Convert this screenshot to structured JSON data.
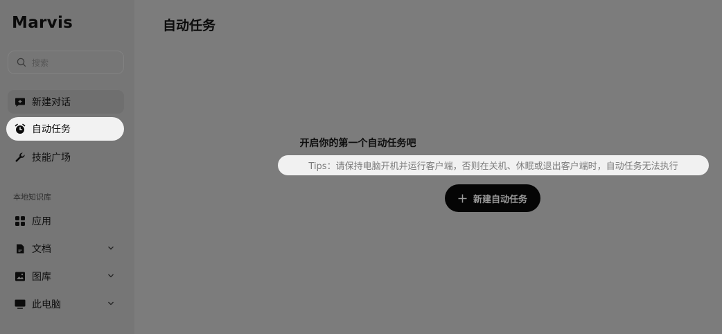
{
  "app": {
    "logo": "Marvis"
  },
  "sidebar": {
    "search_placeholder": "搜索",
    "items": [
      {
        "label": "新建对话",
        "icon": "chat-plus-icon"
      },
      {
        "label": "自动任务",
        "icon": "alarm-clock-icon"
      },
      {
        "label": "技能广场",
        "icon": "wrench-icon"
      }
    ],
    "section_label": "本地知识库",
    "library": [
      {
        "label": "应用",
        "icon": "apps-grid-icon"
      },
      {
        "label": "文档",
        "icon": "document-icon"
      },
      {
        "label": "图库",
        "icon": "image-icon"
      },
      {
        "label": "此电脑",
        "icon": "monitor-icon"
      }
    ]
  },
  "main": {
    "title": "自动任务",
    "empty_title": "开启你的第一个自动任务吧",
    "tips": "Tips：请保持电脑开机并运行客户端，否则在关机、休眠或退出客户端时，自动任务无法执行",
    "new_task_button": "新建自动任务"
  },
  "colors": {
    "overlay_sidebar": "#767676",
    "overlay_main": "#7c7c7c",
    "active_item": "#f2f2f2",
    "button_bg": "#050505"
  }
}
